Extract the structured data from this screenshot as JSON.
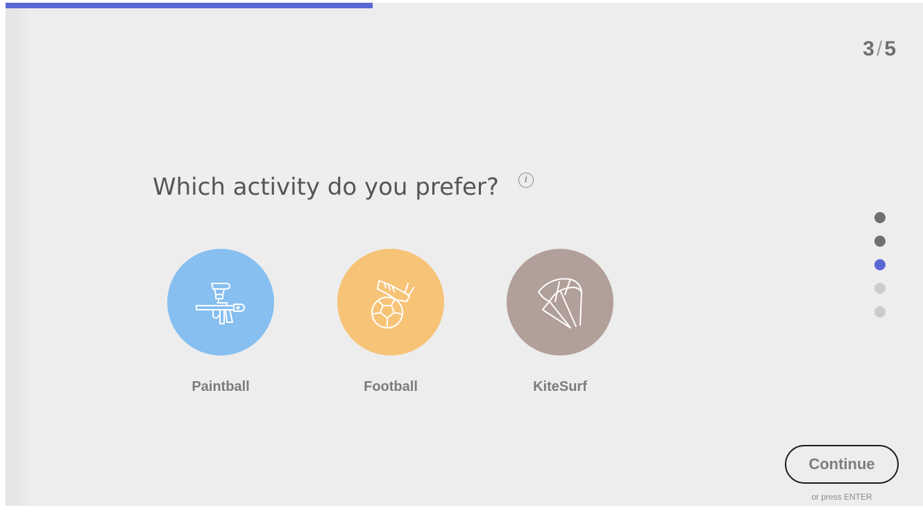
{
  "progress": {
    "fraction": 0.4,
    "color": "#5c67d6"
  },
  "step_counter": {
    "current": "3",
    "separator": "/",
    "total": "5"
  },
  "question": {
    "text": "Which activity do you prefer?",
    "info_icon_glyph": "i"
  },
  "options": [
    {
      "label": "Paintball",
      "icon": "paintball-gun-icon",
      "color": "#86bff0"
    },
    {
      "label": "Football",
      "icon": "football-boot-ball-icon",
      "color": "#f6c377"
    },
    {
      "label": "KiteSurf",
      "icon": "kite-icon",
      "color": "#b19f99"
    }
  ],
  "step_dots": [
    {
      "state": "done",
      "color": "#707070"
    },
    {
      "state": "done",
      "color": "#707070"
    },
    {
      "state": "current",
      "color": "#5c67d6"
    },
    {
      "state": "pending",
      "color": "#cbcbcb"
    },
    {
      "state": "pending",
      "color": "#cbcbcb"
    }
  ],
  "continue": {
    "label": "Continue",
    "hint": "or press ENTER"
  }
}
